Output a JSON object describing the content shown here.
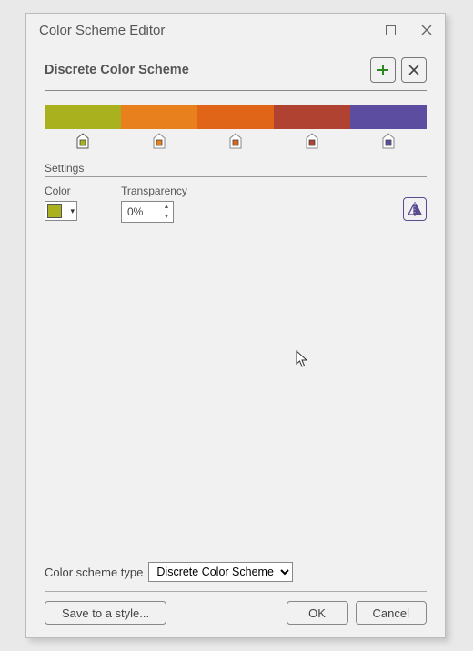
{
  "window": {
    "title": "Color Scheme Editor"
  },
  "header": {
    "title": "Discrete Color Scheme"
  },
  "colors": [
    "#a9b11f",
    "#e9801e",
    "#e06519",
    "#af4231",
    "#5c4da1"
  ],
  "markers": [
    {
      "pos": 10,
      "fill": "#a9b11f"
    },
    {
      "pos": 30,
      "fill": "#e9801e"
    },
    {
      "pos": 50,
      "fill": "#e06519"
    },
    {
      "pos": 70,
      "fill": "#af4231"
    },
    {
      "pos": 90,
      "fill": "#5c4da1"
    }
  ],
  "settings": {
    "section": "Settings",
    "color_label": "Color",
    "color_value": "#a9b11f",
    "transparency_label": "Transparency",
    "transparency_value": "0%"
  },
  "footer": {
    "type_label": "Color scheme type",
    "type_value": "Discrete Color Scheme",
    "save": "Save to a style...",
    "ok": "OK",
    "cancel": "Cancel"
  }
}
